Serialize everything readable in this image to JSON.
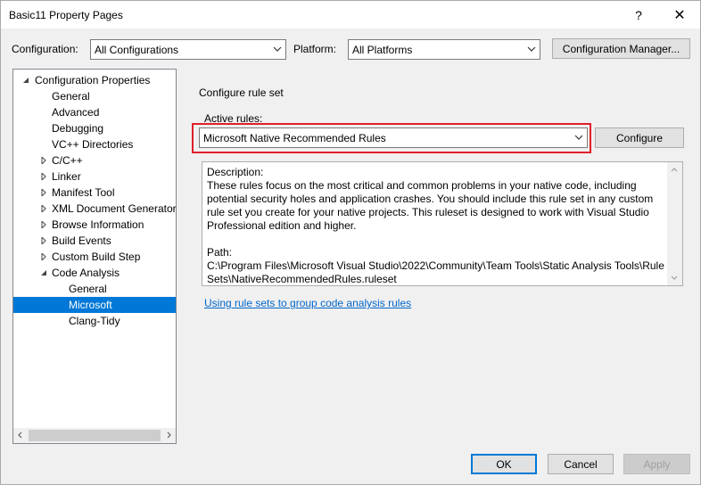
{
  "window": {
    "title": "Basic11 Property Pages",
    "help_glyph": "?",
    "close_glyph": "✕"
  },
  "toolbar": {
    "configuration_label": "Configuration:",
    "configuration_value": "All Configurations",
    "platform_label": "Platform:",
    "platform_value": "All Platforms",
    "config_manager_label": "Configuration Manager..."
  },
  "tree": {
    "items": [
      {
        "label": "Configuration Properties",
        "expanded": true
      },
      {
        "label": "General"
      },
      {
        "label": "Advanced"
      },
      {
        "label": "Debugging"
      },
      {
        "label": "VC++ Directories"
      },
      {
        "label": "C/C++",
        "collapsed": true
      },
      {
        "label": "Linker",
        "collapsed": true
      },
      {
        "label": "Manifest Tool",
        "collapsed": true
      },
      {
        "label": "XML Document Generator",
        "collapsed": true
      },
      {
        "label": "Browse Information",
        "collapsed": true
      },
      {
        "label": "Build Events",
        "collapsed": true
      },
      {
        "label": "Custom Build Step",
        "collapsed": true
      },
      {
        "label": "Code Analysis",
        "expanded": true
      },
      {
        "label": "General"
      },
      {
        "label": "Microsoft",
        "selected": true
      },
      {
        "label": "Clang-Tidy"
      }
    ]
  },
  "main": {
    "section_title": "Configure rule set",
    "active_rules_label": "Active rules:",
    "active_rules_value": "Microsoft Native Recommended Rules",
    "configure_button": "Configure",
    "description": "Description:\nThese rules focus on the most critical and common problems in your native code, including potential security holes and application crashes.  You should include this rule set in any custom rule set you create for your native projects.  This ruleset is designed to work with Visual Studio Professional edition and higher.\n\nPath:\nC:\\Program Files\\Microsoft Visual Studio\\2022\\Community\\Team Tools\\Static Analysis Tools\\Rule Sets\\NativeRecommendedRules.ruleset",
    "link_text": "Using rule sets to group code analysis rules"
  },
  "footer": {
    "ok": "OK",
    "cancel": "Cancel",
    "apply": "Apply"
  },
  "colors": {
    "selection": "#0078d7",
    "highlight_border": "#e0202a",
    "link": "#0066cc"
  }
}
